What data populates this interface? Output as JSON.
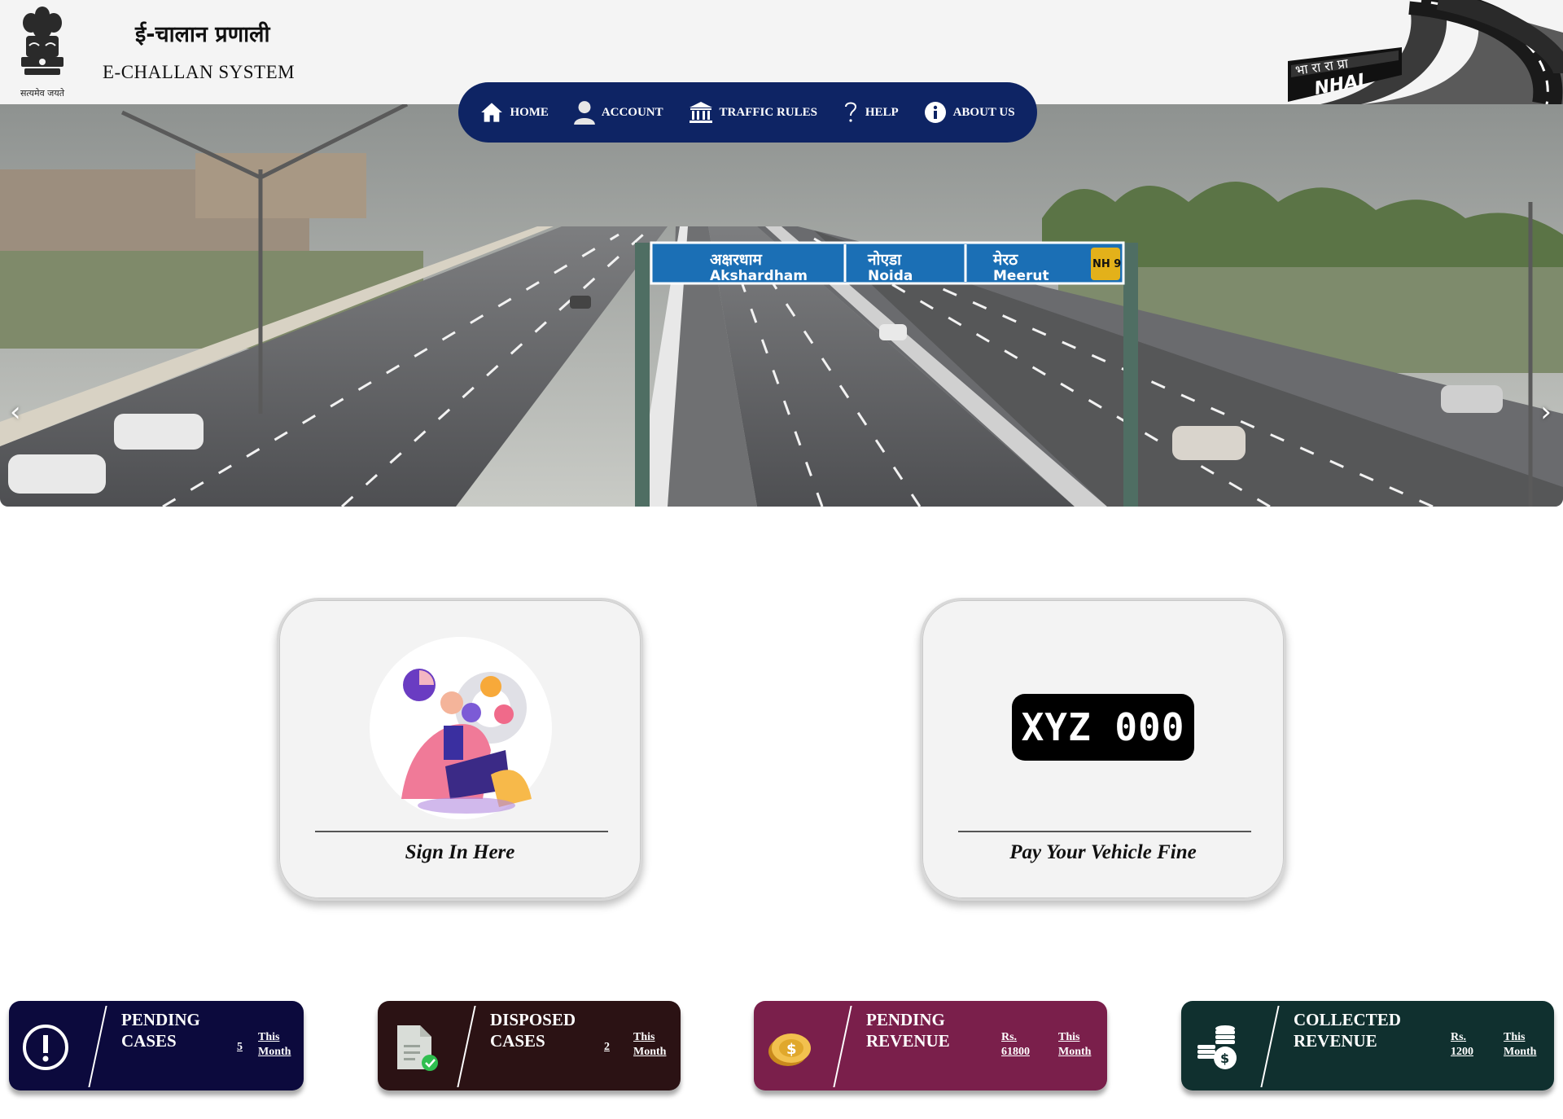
{
  "header": {
    "title_hindi": "ई-चालान प्रणाली",
    "title_english": "E-CHALLAN SYSTEM",
    "emblem_motto": "सत्यमेव जयते",
    "nhai_logo_text_hindi": "भा रा रा प्रा",
    "nhai_logo_text": "NHAI"
  },
  "nav": {
    "items": [
      {
        "label": "HOME",
        "icon": "home-icon"
      },
      {
        "label": "ACCOUNT",
        "icon": "user-icon"
      },
      {
        "label": "TRAFFIC RULES",
        "icon": "building-icon"
      },
      {
        "label": "HELP",
        "icon": "question-icon"
      },
      {
        "label": "ABOUT US",
        "icon": "info-icon"
      }
    ]
  },
  "hero": {
    "prev_arrow": "‹",
    "next_arrow": "›",
    "sign": [
      {
        "hindi": "अक्षरधाम",
        "english": "Akshardham"
      },
      {
        "hindi": "नोएडा",
        "english": "Noida"
      },
      {
        "hindi": "मेरठ",
        "english": "Meerut"
      }
    ],
    "shield": "NH 9"
  },
  "cards": {
    "signin_label": "Sign In Here",
    "pay_label": "Pay Your Vehicle Fine",
    "plate_text": "XYZ 000"
  },
  "stats": [
    {
      "label_line1": "PENDING",
      "label_line2": "CASES",
      "count": "5",
      "period_line1": "This",
      "period_line2": "Month",
      "color": "#0c0a3d",
      "icon": "exclamation-icon"
    },
    {
      "label_line1": "DISPOSED",
      "label_line2": "CASES",
      "count": "2",
      "period_line1": "This",
      "period_line2": "Month",
      "color": "#2b1214",
      "icon": "document-check-icon"
    },
    {
      "label_line1": "PENDING",
      "label_line2": "REVENUE",
      "count_line1": "Rs.",
      "count_line2": "61800",
      "period_line1": "This",
      "period_line2": "Month",
      "color": "#7a1f4b",
      "icon": "coins-icon"
    },
    {
      "label_line1": "COLLECTED",
      "label_line2": "REVENUE",
      "count_line1": "Rs.",
      "count_line2": "1200",
      "period_line1": "This",
      "period_line2": "Month",
      "color": "#10302f",
      "icon": "money-stack-icon"
    }
  ]
}
